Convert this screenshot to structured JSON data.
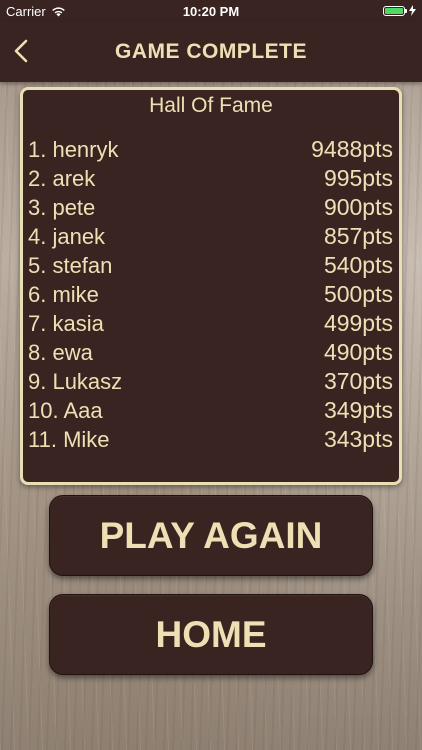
{
  "status_bar": {
    "carrier": "Carrier",
    "time": "10:20 PM",
    "wifi_icon": "wifi-icon",
    "battery_icon": "battery-icon",
    "charging_icon": "charging-bolt-icon"
  },
  "nav": {
    "back_icon": "chevron-left-icon",
    "title": "GAME COMPLETE"
  },
  "hall_of_fame": {
    "title": "Hall Of Fame",
    "entries": [
      {
        "name": "1. henryk",
        "points": "9488pts"
      },
      {
        "name": "2. arek",
        "points": "995pts"
      },
      {
        "name": "3. pete",
        "points": "900pts"
      },
      {
        "name": "4. janek",
        "points": "857pts"
      },
      {
        "name": "5. stefan",
        "points": "540pts"
      },
      {
        "name": "6. mike",
        "points": "500pts"
      },
      {
        "name": "7. kasia",
        "points": "499pts"
      },
      {
        "name": "8. ewa",
        "points": "490pts"
      },
      {
        "name": "9. Lukasz",
        "points": "370pts"
      },
      {
        "name": "10. Aaa",
        "points": "349pts"
      },
      {
        "name": "11. Mike",
        "points": "343pts"
      }
    ]
  },
  "buttons": {
    "play_again": "PLAY AGAIN",
    "home": "HOME"
  },
  "colors": {
    "panel_bg": "#3a2421",
    "text_cream": "#eee0b4",
    "border_cream": "#e9dfb5",
    "battery_green": "#4cd964"
  }
}
